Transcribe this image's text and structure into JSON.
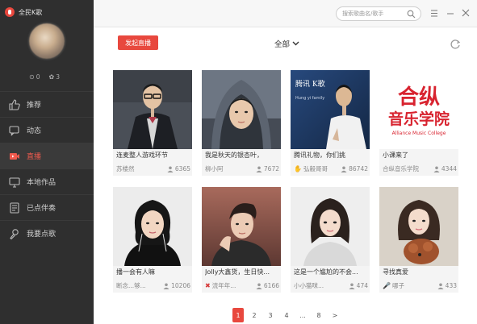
{
  "app": {
    "name": "全民K歌"
  },
  "profile": {
    "stat_a": "0",
    "stat_b": "3"
  },
  "sidebar": {
    "items": [
      {
        "label": "推荐",
        "icon": "thumbs-up-icon"
      },
      {
        "label": "动态",
        "icon": "chat-bubble-icon"
      },
      {
        "label": "直播",
        "icon": "video-camera-icon"
      },
      {
        "label": "本地作品",
        "icon": "monitor-icon"
      },
      {
        "label": "已点伴奏",
        "icon": "document-list-icon"
      },
      {
        "label": "我要点歌",
        "icon": "microphone-icon"
      }
    ]
  },
  "search": {
    "placeholder": "搜索歌曲名/歌手"
  },
  "toolbar": {
    "live_button": "发起直播",
    "filter_label": "全部"
  },
  "cards": [
    {
      "title": "连麦整人游戏环节",
      "user": "苏楼然",
      "viewers": "6365"
    },
    {
      "title": "我是秋天的银杏叶，",
      "user": "柳小阿",
      "viewers": "7672"
    },
    {
      "title": "腾讯礼物，你们挑",
      "user": "弘毅哥哥",
      "viewers": "86742"
    },
    {
      "title": "小课来了",
      "user": "合纵音乐学院",
      "viewers": "4344"
    },
    {
      "title": "播一会有人嘛",
      "user": "断念...够...",
      "viewers": "10206"
    },
    {
      "title": "Jolly大鑫货，生日快...",
      "user": "流年年...",
      "viewers": "6166"
    },
    {
      "title": "这是一个尴尬的不会...",
      "user": "小小猫咪...",
      "viewers": "474"
    },
    {
      "title": "寻找真爱",
      "user": "哪子",
      "viewers": "433"
    }
  ],
  "poster": {
    "line1": "合纵",
    "line2": "音乐学院",
    "line3": "Alliance Music College"
  },
  "cover_text": {
    "line1": "腾讯 K歌",
    "line2": "Hung yi family"
  },
  "pagination": {
    "pages": [
      "1",
      "2",
      "3",
      "4",
      "...",
      "8"
    ],
    "next": ">"
  },
  "colors": {
    "accent": "#e8483e",
    "sidebar": "#2f2f2f"
  }
}
